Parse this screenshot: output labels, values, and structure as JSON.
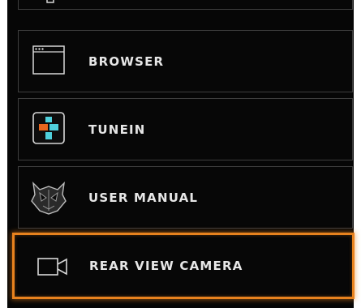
{
  "menu": {
    "items": [
      {
        "label": "",
        "icon": "monitor-icon"
      },
      {
        "label": "BROWSER",
        "icon": "browser-window-icon"
      },
      {
        "label": "TUNEIN",
        "icon": "tunein-icon"
      },
      {
        "label": "USER MANUAL",
        "icon": "user-manual-icon"
      },
      {
        "label": "REAR VIEW CAMERA",
        "icon": "camera-icon",
        "selected": true
      }
    ]
  },
  "colors": {
    "background": "#060606",
    "border": "#3e3e3e",
    "text": "#e6e6e6",
    "accent": "#e8821e",
    "tunein_orange": "#e8661e",
    "tunein_cyan": "#4fd0dc"
  }
}
